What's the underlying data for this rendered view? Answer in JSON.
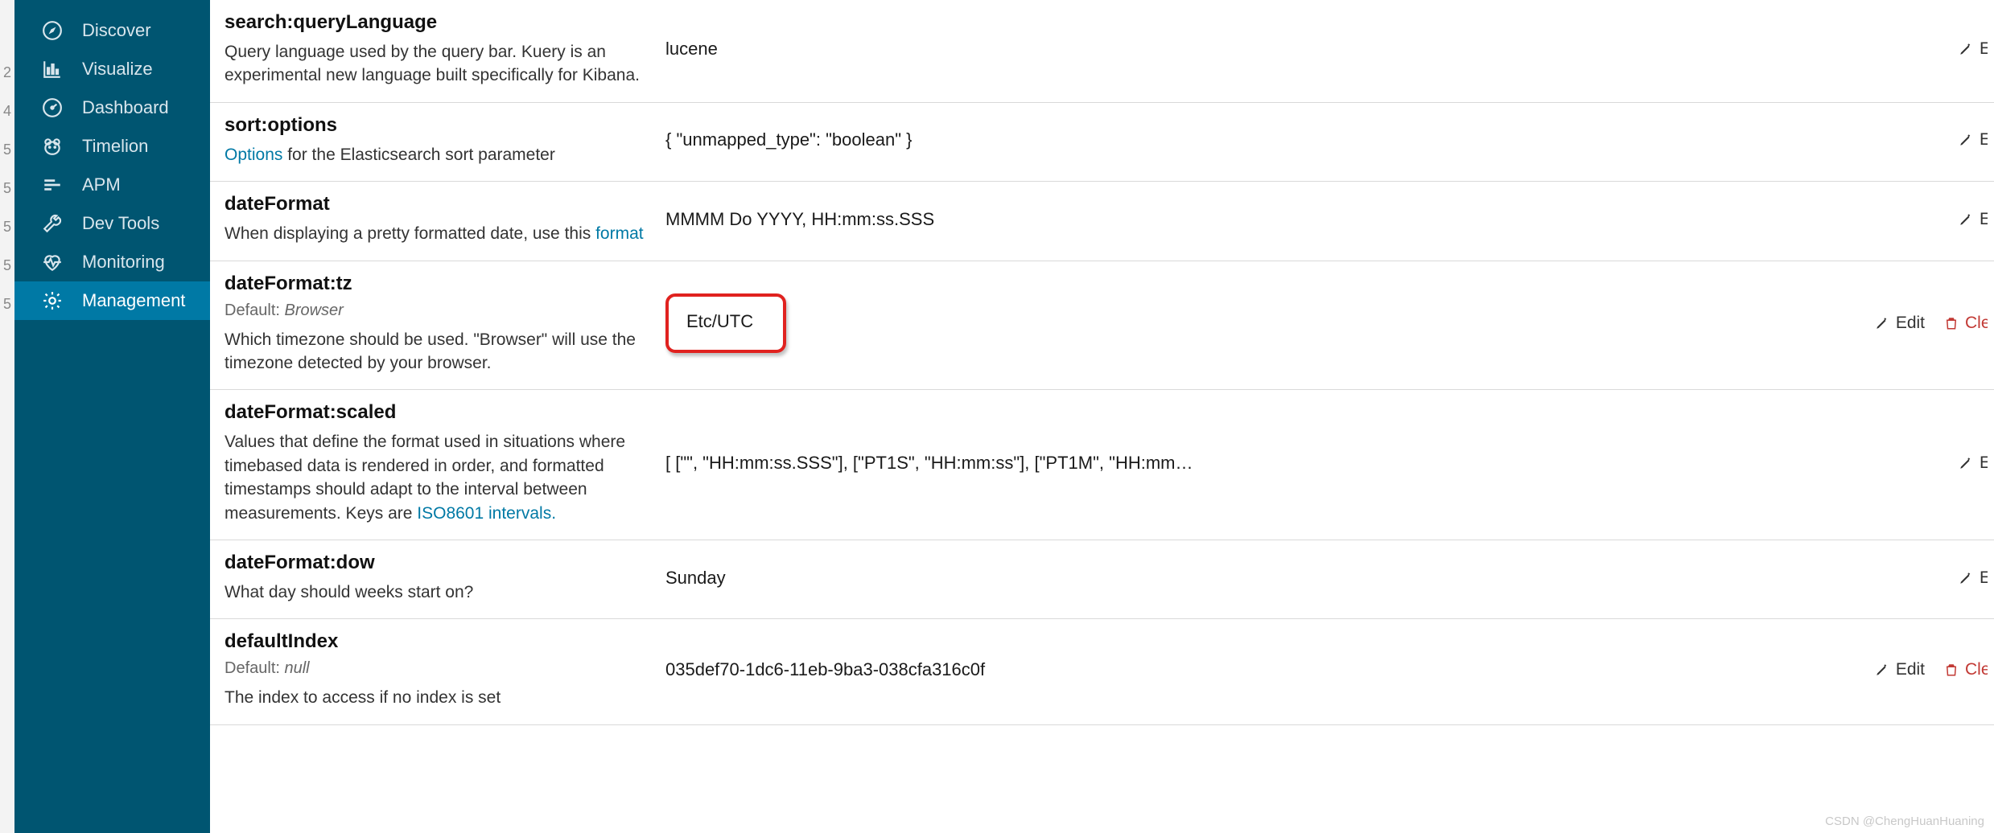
{
  "sidebar": {
    "items": [
      {
        "label": "Discover",
        "icon": "compass-icon"
      },
      {
        "label": "Visualize",
        "icon": "bar-chart-icon"
      },
      {
        "label": "Dashboard",
        "icon": "gauge-icon"
      },
      {
        "label": "Timelion",
        "icon": "bear-icon"
      },
      {
        "label": "APM",
        "icon": "apm-icon"
      },
      {
        "label": "Dev Tools",
        "icon": "wrench-icon"
      },
      {
        "label": "Monitoring",
        "icon": "heartbeat-icon"
      },
      {
        "label": "Management",
        "icon": "gear-icon"
      }
    ],
    "active_index": 7
  },
  "actions": {
    "edit": "Edit",
    "clear": "Cle",
    "e": "E"
  },
  "settings": [
    {
      "id": "search-query-language",
      "name": "search:queryLanguage",
      "desc_pre": "Query language used by the query bar. Kuery is an experimental new language built specifically for Kibana.",
      "value": "lucene",
      "actions": [
        "pencil-e"
      ]
    },
    {
      "id": "sort-options",
      "name": "sort:options",
      "link_text": "Options",
      "desc_post": " for the Elasticsearch sort parameter",
      "value": "{ \"unmapped_type\": \"boolean\" }",
      "actions": [
        "pencil-e"
      ]
    },
    {
      "id": "date-format",
      "name": "dateFormat",
      "desc_pre": "When displaying a pretty formatted date, use this ",
      "link_text": "format",
      "value": "MMMM Do YYYY, HH:mm:ss.SSS",
      "actions": [
        "pencil-e"
      ]
    },
    {
      "id": "date-format-tz",
      "name": "dateFormat:tz",
      "default": "Browser",
      "desc_pre": "Which timezone should be used. \"Browser\" will use the timezone detected by your browser.",
      "value": "Etc/UTC",
      "highlight": true,
      "actions": [
        "edit",
        "clear"
      ]
    },
    {
      "id": "date-format-scaled",
      "name": "dateFormat:scaled",
      "desc_pre": "Values that define the format used in situations where timebased data is rendered in order, and formatted timestamps should adapt to the interval between measurements. Keys are ",
      "link_text": "ISO8601 intervals.",
      "value": "[ [\"\", \"HH:mm:ss.SSS\"], [\"PT1S\", \"HH:mm:ss\"], [\"PT1M\", \"HH:mm…",
      "actions": [
        "pencil-e"
      ]
    },
    {
      "id": "date-format-dow",
      "name": "dateFormat:dow",
      "desc_pre": "What day should weeks start on?",
      "value": "Sunday",
      "actions": [
        "pencil-e"
      ]
    },
    {
      "id": "default-index",
      "name": "defaultIndex",
      "default": "null",
      "desc_pre": "The index to access if no index is set",
      "value": "035def70-1dc6-11eb-9ba3-038cfa316c0f",
      "actions": [
        "edit",
        "clear"
      ]
    }
  ],
  "watermark": "CSDN @ChengHuanHuaning"
}
